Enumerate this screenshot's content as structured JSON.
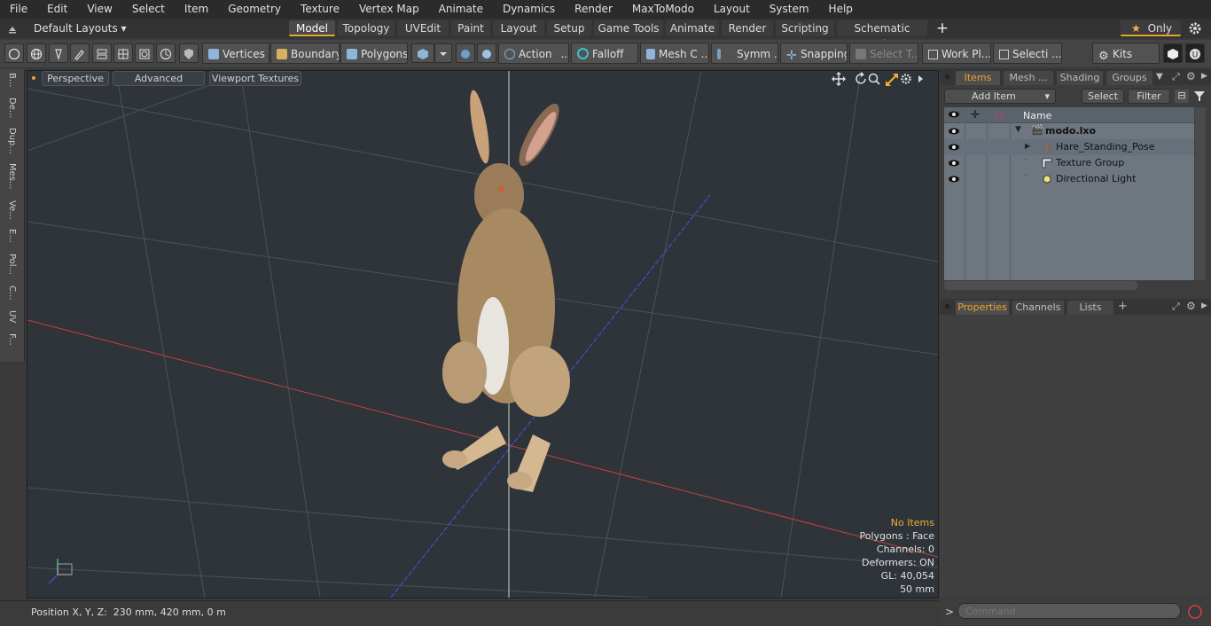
{
  "menubar": {
    "items": [
      "File",
      "Edit",
      "View",
      "Select",
      "Item",
      "Geometry",
      "Texture",
      "Vertex Map",
      "Animate",
      "Dynamics",
      "Render",
      "MaxToModo",
      "Layout",
      "System",
      "Help"
    ]
  },
  "layoutbar": {
    "layouts_dropdown": "Default Layouts",
    "tabs": [
      "Model",
      "Topology",
      "UVEdit",
      "Paint",
      "Layout",
      "Setup",
      "Game Tools",
      "Animate",
      "Render",
      "Scripting",
      "Schematic Fusion"
    ],
    "active_tab": "Model",
    "add_tab": "+",
    "only_label": "Only"
  },
  "toolbar": {
    "vertices": "Vertices",
    "boundary": "Boundary",
    "polygons": "Polygons",
    "action": "Action",
    "action_more": "...",
    "falloff": "Falloff",
    "mesh_c": "Mesh C ...",
    "symm": "Symm ...",
    "snapping": "Snapping",
    "select_t": "Select T...",
    "work_pl": "Work Pl...",
    "selecti": "Selecti ...",
    "kits": "Kits"
  },
  "leftstrip": {
    "tabs": [
      "B...",
      "De...",
      "Dup...",
      "Mes...",
      "Ve...",
      "E...",
      "Pol...",
      "C...",
      "UV",
      "F..."
    ]
  },
  "viewport": {
    "perspective": "Perspective",
    "advanced": "Advanced",
    "viewport_textures": "Viewport Textures",
    "info": {
      "no_items": "No Items",
      "polygons": "Polygons : Face",
      "channels": "Channels: 0",
      "deformers": "Deformers: ON",
      "gl": "GL: 40,054",
      "scale": "50 mm"
    }
  },
  "items_panel": {
    "tabs": [
      "Items",
      "Mesh ...",
      "Shading",
      "Groups"
    ],
    "active_tab": "Items",
    "add_item": "Add Item",
    "select": "Select",
    "filter": "Filter",
    "column_name": "Name",
    "tree": [
      {
        "label": "modo.lxo",
        "bold": true
      },
      {
        "label": "Hare_Standing_Pose",
        "bold": false
      },
      {
        "label": "Texture Group",
        "bold": false
      },
      {
        "label": "Directional Light",
        "bold": false
      }
    ]
  },
  "properties_panel": {
    "tabs": [
      "Properties",
      "Channels",
      "Lists"
    ],
    "active_tab": "Properties",
    "add": "+"
  },
  "statusbar": {
    "position": "Position X, Y, Z:  230 mm, 420 mm, 0 m"
  },
  "command": {
    "placeholder": "Command",
    "prompt": ">"
  },
  "colors": {
    "accent": "#e8a23a",
    "viewport_bg": "#2e343a",
    "x_axis": "#c84040",
    "z_axis": "#4050c8"
  }
}
